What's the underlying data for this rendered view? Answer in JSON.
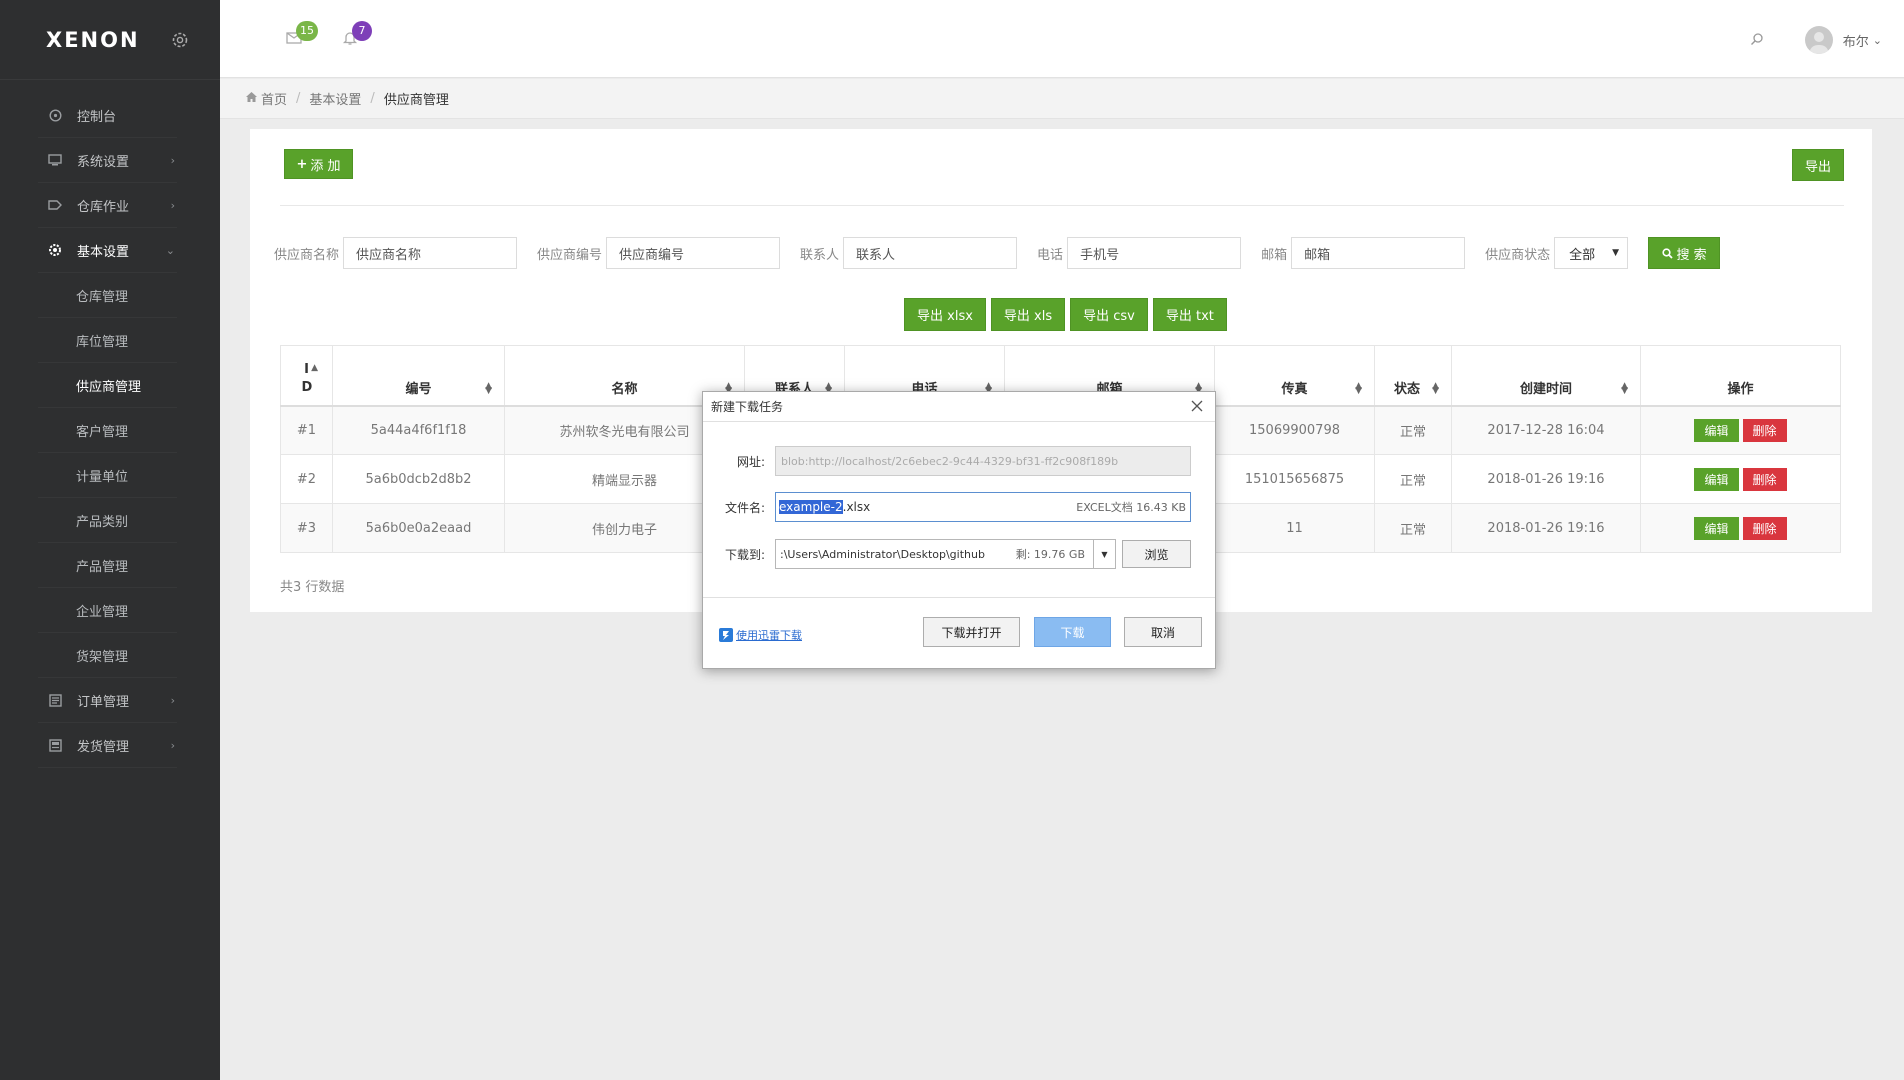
{
  "brand": {
    "name": "XENON"
  },
  "sidebar": {
    "items": [
      {
        "label": "控制台",
        "icon": "dashboard-icon"
      },
      {
        "label": "系统设置",
        "icon": "monitor-icon"
      },
      {
        "label": "仓库作业",
        "icon": "tag-icon"
      },
      {
        "label": "基本设置",
        "icon": "settings-icon"
      },
      {
        "label": "订单管理",
        "icon": "order-icon"
      },
      {
        "label": "发货管理",
        "icon": "shipping-icon"
      }
    ],
    "subitems": [
      "仓库管理",
      "库位管理",
      "供应商管理",
      "客户管理",
      "计量单位",
      "产品类别",
      "产品管理",
      "企业管理",
      "货架管理"
    ]
  },
  "topbar": {
    "mail_count": "15",
    "notify_count": "7",
    "user_name": "布尔",
    "mail_color": "#7ab648",
    "notify_color": "#7e3fb8"
  },
  "breadcrumb": {
    "home": "首页",
    "level1": "基本设置",
    "current": "供应商管理"
  },
  "toolbar": {
    "add_label": "添 加",
    "export_label": "导出"
  },
  "filters": {
    "supplier_name_label": "供应商名称",
    "supplier_name_placeholder": "供应商名称",
    "supplier_code_label": "供应商编号",
    "supplier_code_placeholder": "供应商编号",
    "contact_label": "联系人",
    "contact_placeholder": "联系人",
    "phone_label": "电话",
    "phone_placeholder": "手机号",
    "email_label": "邮箱",
    "email_placeholder": "邮箱",
    "status_label": "供应商状态",
    "status_value": "全部",
    "search_label": "搜 索"
  },
  "exports": [
    "导出 xlsx",
    "导出 xls",
    "导出 csv",
    "导出 txt"
  ],
  "table": {
    "headers": [
      "I D",
      "编号",
      "名称",
      "联系人",
      "电话",
      "邮箱",
      "传真",
      "状态",
      "创建时间",
      "操作"
    ],
    "rows": [
      {
        "id": "#1",
        "code": "5a44a4f6f1f18",
        "name": "苏州软冬光电有限公司",
        "fax": "15069900798",
        "status": "正常",
        "created": "2017-12-28 16:04"
      },
      {
        "id": "#2",
        "code": "5a6b0dcb2d8b2",
        "name": "精端显示器",
        "fax": "151015656875",
        "status": "正常",
        "created": "2018-01-26 19:16"
      },
      {
        "id": "#3",
        "code": "5a6b0e0a2eaad",
        "name": "伟创力电子",
        "fax": "11",
        "status": "正常",
        "created": "2018-01-26 19:16"
      }
    ],
    "edit_label": "编辑",
    "delete_label": "删除",
    "summary": "共3 行数据"
  },
  "dialog": {
    "title": "新建下载任务",
    "url_label": "网址:",
    "url_value": "blob:http://localhost/2c6ebec2-9c44-4329-bf31-ff2c908f189b",
    "filename_label": "文件名:",
    "filename_selected": "example-2",
    "filename_ext": ".xlsx",
    "file_info": "EXCEL文档 16.43 KB",
    "saveto_label": "下载到:",
    "saveto_path": ":\\Users\\Administrator\\Desktop\\github",
    "saveto_free": "剩: 19.76 GB",
    "browse_label": "浏览",
    "thunder_label": "使用迅雷下载",
    "download_open_label": "下载并打开",
    "download_label": "下载",
    "cancel_label": "取消"
  }
}
